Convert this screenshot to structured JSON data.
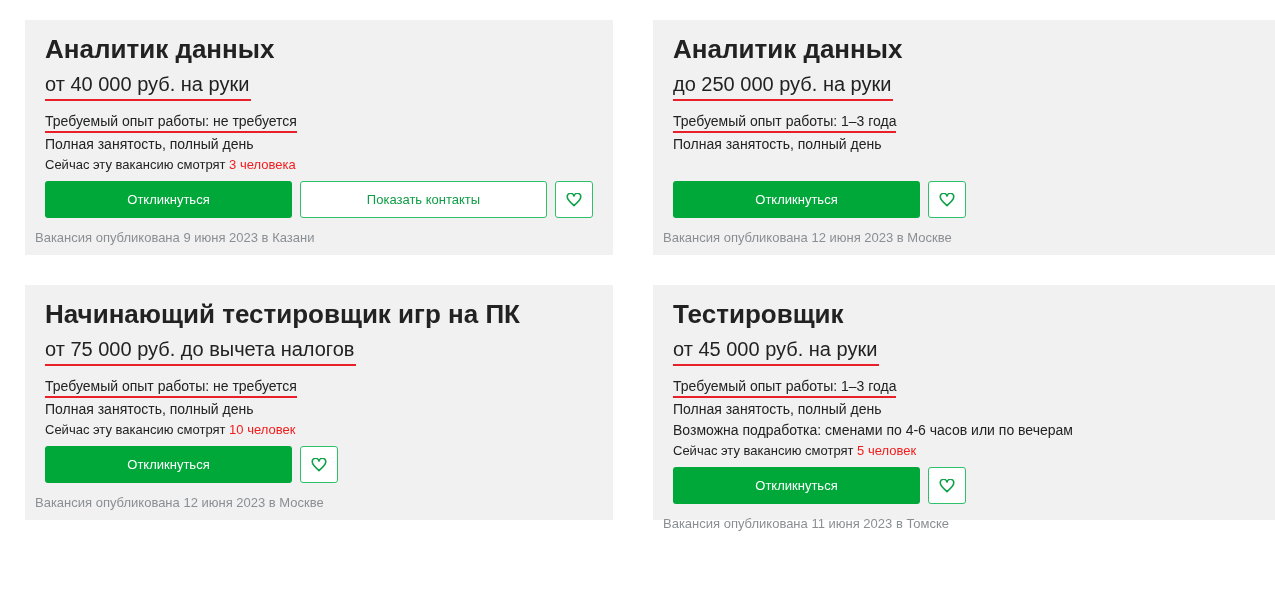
{
  "vacancies": [
    {
      "title": "Аналитик данных",
      "salary": {
        "text": "от 40 000 руб. на руки",
        "underlined": true
      },
      "experience": {
        "text": "Требуемый опыт работы: не требуется",
        "underlined": true
      },
      "details": [
        "Полная занятость, полный день"
      ],
      "viewers": {
        "prefix": "Сейчас эту вакансию смотрят",
        "count": "3 человека"
      },
      "respond_button": "Откликнуться",
      "contacts_button": "Показать контакты",
      "published": "Вакансия опубликована 9 июня 2023 в Казани"
    },
    {
      "title": "Аналитик данных",
      "salary": {
        "text": "до 250 000 руб. на руки",
        "underlined": true
      },
      "experience": {
        "text": "Требуемый опыт работы: 1–3 года",
        "underlined": true
      },
      "details": [
        "Полная занятость, полный день"
      ],
      "respond_button": "Откликнуться",
      "published": "Вакансия опубликована 12 июня 2023 в Москве"
    },
    {
      "title": "Начинающий тестировщик игр на ПК",
      "salary": {
        "text": "от 75 000 руб. до вычета налогов",
        "underlined": true
      },
      "experience": {
        "text": "Требуемый опыт работы: не требуется",
        "underlined": true
      },
      "details": [
        "Полная занятость, полный день"
      ],
      "viewers": {
        "prefix": "Сейчас эту вакансию смотрят",
        "count": "10 человек"
      },
      "respond_button": "Откликнуться",
      "published": "Вакансия опубликована 12 июня 2023 в Москве"
    },
    {
      "title": "Тестировщик",
      "salary": {
        "text": "от 45 000 руб. на руки",
        "underlined": true
      },
      "experience": {
        "text": "Требуемый опыт работы: 1–3 года",
        "underlined": true
      },
      "details": [
        "Полная занятость, полный день",
        "Возможна подработка: сменами по 4-6 часов или по вечерам"
      ],
      "viewers": {
        "prefix": "Сейчас эту вакансию смотрят",
        "count": "5 человек"
      },
      "respond_button": "Откликнуться",
      "published": "Вакансия опубликована 11 июня 2023 в Томске"
    }
  ]
}
